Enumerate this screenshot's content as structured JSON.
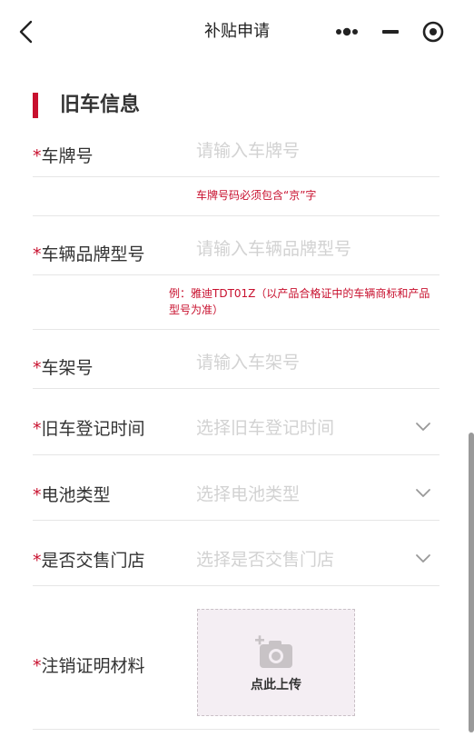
{
  "header": {
    "title": "补贴申请"
  },
  "section": {
    "title": "旧车信息"
  },
  "fields": {
    "plate": {
      "required": "*",
      "label": "车牌号",
      "placeholder": "请输入车牌号",
      "hint": "车牌号码必须包含“京”字"
    },
    "model": {
      "required": "*",
      "label": "车辆品牌型号",
      "placeholder": "请输入车辆品牌型号",
      "hint_line1": "例：雅迪TDT01Z（以产品合格证中的车辆商标和产品",
      "hint_line2": "型号为准）"
    },
    "frame": {
      "required": "*",
      "label": "车架号",
      "placeholder": "请输入车架号"
    },
    "reg_time": {
      "required": "*",
      "label": "旧车登记时间",
      "placeholder": "选择旧车登记时间"
    },
    "battery": {
      "required": "*",
      "label": "电池类型",
      "placeholder": "选择电池类型"
    },
    "store": {
      "required": "*",
      "label": "是否交售门店",
      "placeholder": "选择是否交售门店"
    },
    "cancel_proof": {
      "required": "*",
      "label": "注销证明材料",
      "upload_label": "点此上传"
    }
  },
  "icons": {
    "back": "chevron-left-icon",
    "more": "more-dots-icon",
    "minimize": "minimize-icon",
    "close": "target-circle-icon",
    "dropdown": "chevron-down-icon",
    "camera": "camera-plus-icon"
  },
  "colors": {
    "accent": "#c8102e",
    "placeholder": "#d2d2d2",
    "upload_bg": "#f4eef3"
  }
}
